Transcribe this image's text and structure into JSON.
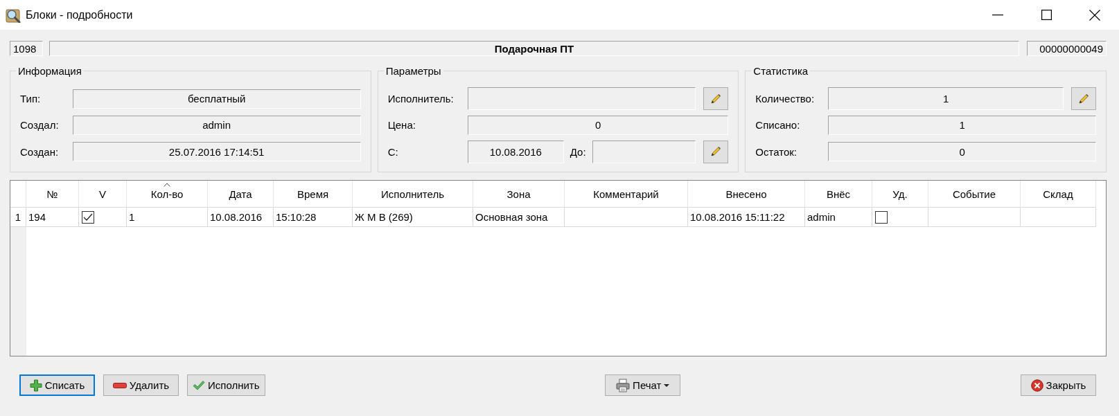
{
  "window": {
    "title": "Блоки - подробности"
  },
  "header": {
    "id": "1098",
    "name": "Подарочная ПТ",
    "code": "00000000049"
  },
  "groups": [
    {
      "title": "Информация",
      "rows": [
        {
          "editable": false,
          "fields": [
            {
              "label": "Тип:",
              "value": "бесплатный"
            }
          ]
        },
        {
          "editable": false,
          "fields": [
            {
              "label": "Создал:",
              "value": "admin"
            }
          ]
        },
        {
          "editable": false,
          "fields": [
            {
              "label": "Создан:",
              "value": "25.07.2016 17:14:51"
            }
          ]
        }
      ]
    },
    {
      "title": "Параметры",
      "rows": [
        {
          "editable": true,
          "fields": [
            {
              "label": "Исполнитель:"
            }
          ]
        },
        {
          "editable": false,
          "fields": [
            {
              "label": "Цена:",
              "value": "0"
            }
          ]
        },
        {
          "editable": true,
          "fields": [
            {
              "label": "С:",
              "value": "10.08.2016"
            },
            {
              "label": "До:"
            }
          ]
        }
      ]
    },
    {
      "title": "Статистика",
      "rows": [
        {
          "editable": true,
          "fields": [
            {
              "label": "Количество:",
              "value": "1"
            }
          ]
        },
        {
          "editable": false,
          "fields": [
            {
              "label": "Списано:",
              "value": "1"
            }
          ]
        },
        {
          "editable": false,
          "fields": [
            {
              "label": "Остаток:",
              "value": "0"
            }
          ]
        }
      ]
    }
  ],
  "table": {
    "columns": [
      {
        "label": "№",
        "sorted": false
      },
      {
        "label": "V",
        "sorted": false
      },
      {
        "label": "Кол-во",
        "sorted": true
      },
      {
        "label": "Дата",
        "sorted": false
      },
      {
        "label": "Время",
        "sorted": false
      },
      {
        "label": "Исполнитель",
        "sorted": false
      },
      {
        "label": "Зона",
        "sorted": false
      },
      {
        "label": "Комментарий",
        "sorted": false
      },
      {
        "label": "Внесено",
        "sorted": false
      },
      {
        "label": "Внёс",
        "sorted": false
      },
      {
        "label": "Уд.",
        "sorted": false
      },
      {
        "label": "Событие",
        "sorted": false
      },
      {
        "label": "Склад",
        "sorted": false
      }
    ],
    "rows": [
      {
        "row_header": "1",
        "cells": [
          {
            "kind": "text",
            "text": "194"
          },
          {
            "kind": "checkbox",
            "checked": true
          },
          {
            "kind": "text",
            "text": "1"
          },
          {
            "kind": "text",
            "text": "10.08.2016"
          },
          {
            "kind": "text",
            "text": "15:10:28"
          },
          {
            "kind": "text",
            "text": "Ж М В (269)"
          },
          {
            "kind": "text",
            "text": "Основная зона"
          },
          {
            "kind": "blank"
          },
          {
            "kind": "text",
            "text": "10.08.2016 15:11:22"
          },
          {
            "kind": "text",
            "text": "admin"
          },
          {
            "kind": "checkbox",
            "checked": false
          },
          {
            "kind": "blank"
          },
          {
            "kind": "blank"
          }
        ]
      }
    ]
  },
  "footer": {
    "left": [
      {
        "label": "Списать",
        "kind": "add",
        "focused": true,
        "has_menu": false
      },
      {
        "label": "Удалить",
        "kind": "remove",
        "focused": false,
        "has_menu": false
      },
      {
        "label": "Исполнить",
        "kind": "confirm",
        "focused": false,
        "has_menu": false
      }
    ],
    "center": [
      {
        "label": "Печат",
        "kind": "print",
        "focused": false,
        "has_menu": true
      }
    ],
    "right": [
      {
        "label": "Закрыть",
        "kind": "close",
        "focused": false,
        "has_menu": false
      }
    ]
  }
}
